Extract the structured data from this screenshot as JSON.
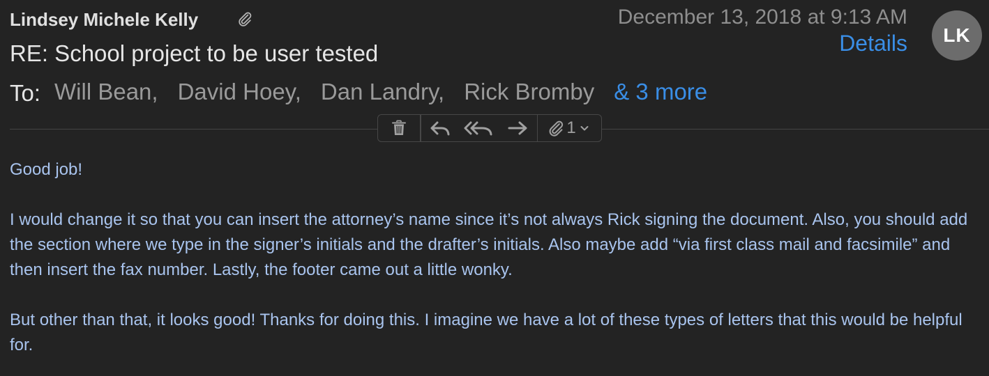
{
  "message": {
    "sender": "Lindsey Michele Kelly",
    "date": "December 13, 2018 at 9:13 AM",
    "details_label": "Details",
    "avatar_initials": "LK",
    "subject": "RE: School project to be user tested",
    "to_label": "To:",
    "recipients": [
      "Will Bean,",
      "David Hoey,",
      "Dan Landry,",
      "Rick Bromby"
    ],
    "more_recipients": "& 3 more"
  },
  "toolbar": {
    "attachment_count": "1",
    "icons": [
      "trash-icon",
      "reply-icon",
      "reply-all-icon",
      "forward-icon",
      "paperclip-icon",
      "chevron-down-icon"
    ]
  },
  "body": {
    "paragraphs": [
      "Good job!",
      "I would change it so that you can insert the attorney’s name since it’s not always Rick signing the document. Also, you should add the section where we type in the signer’s initials and the drafter’s initials. Also maybe add “via first class mail and facsimile” and then insert the fax number. Lastly, the footer came out a little wonky.",
      "But other than that, it looks good! Thanks for doing this. I imagine we have a lot of these types of letters that this would be helpful for."
    ]
  },
  "colors": {
    "background": "#232323",
    "link": "#3a8ee6",
    "body_text": "#a9c4ee",
    "avatar": "#6c6c6c"
  }
}
